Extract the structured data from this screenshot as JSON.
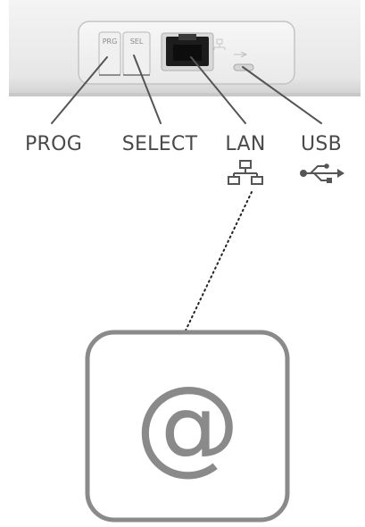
{
  "device": {
    "buttons": {
      "prog_short": "PRG",
      "select_short": "SEL"
    }
  },
  "callouts": {
    "prog": "PROG",
    "select": "SELECT",
    "lan": "LAN",
    "usb": "USB"
  },
  "icons": {
    "lan": "network-icon",
    "usb": "usb-icon",
    "internet": "at-sign-icon"
  },
  "internet_box": {
    "symbol": "@"
  },
  "colors": {
    "device_body": "#ececec",
    "line": "#555555",
    "box_border": "#8a8a8a",
    "text": "#4a4a4a"
  }
}
